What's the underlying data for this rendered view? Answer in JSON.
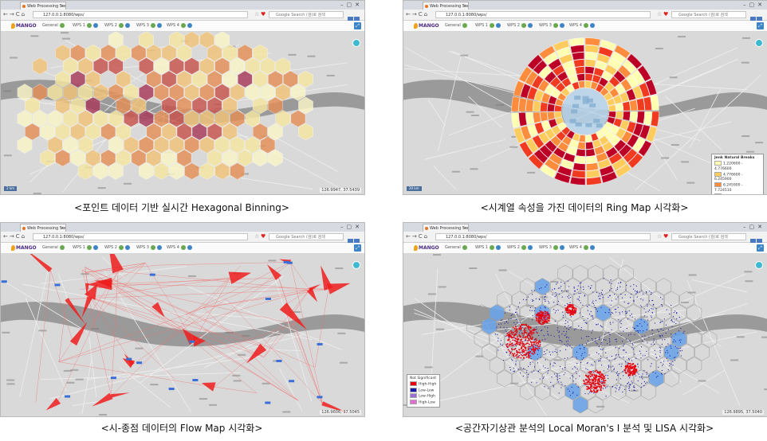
{
  "browser": {
    "tab_title": "Web Processing Service",
    "url": "127.0.0.1:8080/wps/",
    "search_placeholder": "Google Search (검)로 검색",
    "app_logo": "MANGO",
    "menus": [
      "General",
      "WPS 1",
      "WPS 2",
      "WPS 3",
      "WPS 4"
    ]
  },
  "panels": [
    {
      "caption": "<포인트 데이터 기반 실시간 Hexagonal Binning>",
      "coords": "126.9947, 37.5439",
      "scale": "2 km"
    },
    {
      "caption": "<시계열 속성을 가진 데이터의 Ring Map 시각화>",
      "coords": "127.1315, 37.5457",
      "scale": "20 km",
      "legend": {
        "title": "Jenk Natural Breaks",
        "items": [
          {
            "label": "1.220600 - 4.776600",
            "color": "#ffffb2"
          },
          {
            "label": "4.776600 - 6.245900",
            "color": "#fecc5c"
          },
          {
            "label": "6.245900 - 7.724510",
            "color": "#fd8d3c"
          },
          {
            "label": "7.724510 - 9.396440",
            "color": "#f03b20"
          },
          {
            "label": "9.396440 - 11.171460",
            "color": "#bd0026"
          }
        ]
      }
    },
    {
      "caption": "<시-종점 데이터의 Flow Map 시각화>",
      "coords": "126.9606, 37.5045",
      "scale": ""
    },
    {
      "caption": "<공간자기상관 분석의 Local Moran's I 분석 및 LISA 시각화>",
      "coords": "126.9895, 37.5040",
      "scale": "",
      "legend": {
        "title": "Not Significant",
        "items": [
          {
            "label": "High-High",
            "color": "#e8000e"
          },
          {
            "label": "Low-Low",
            "color": "#1a1aa8"
          },
          {
            "label": "Low-High",
            "color": "#9a6fd6"
          },
          {
            "label": "High-Low",
            "color": "#e06fd0"
          }
        ]
      }
    }
  ]
}
